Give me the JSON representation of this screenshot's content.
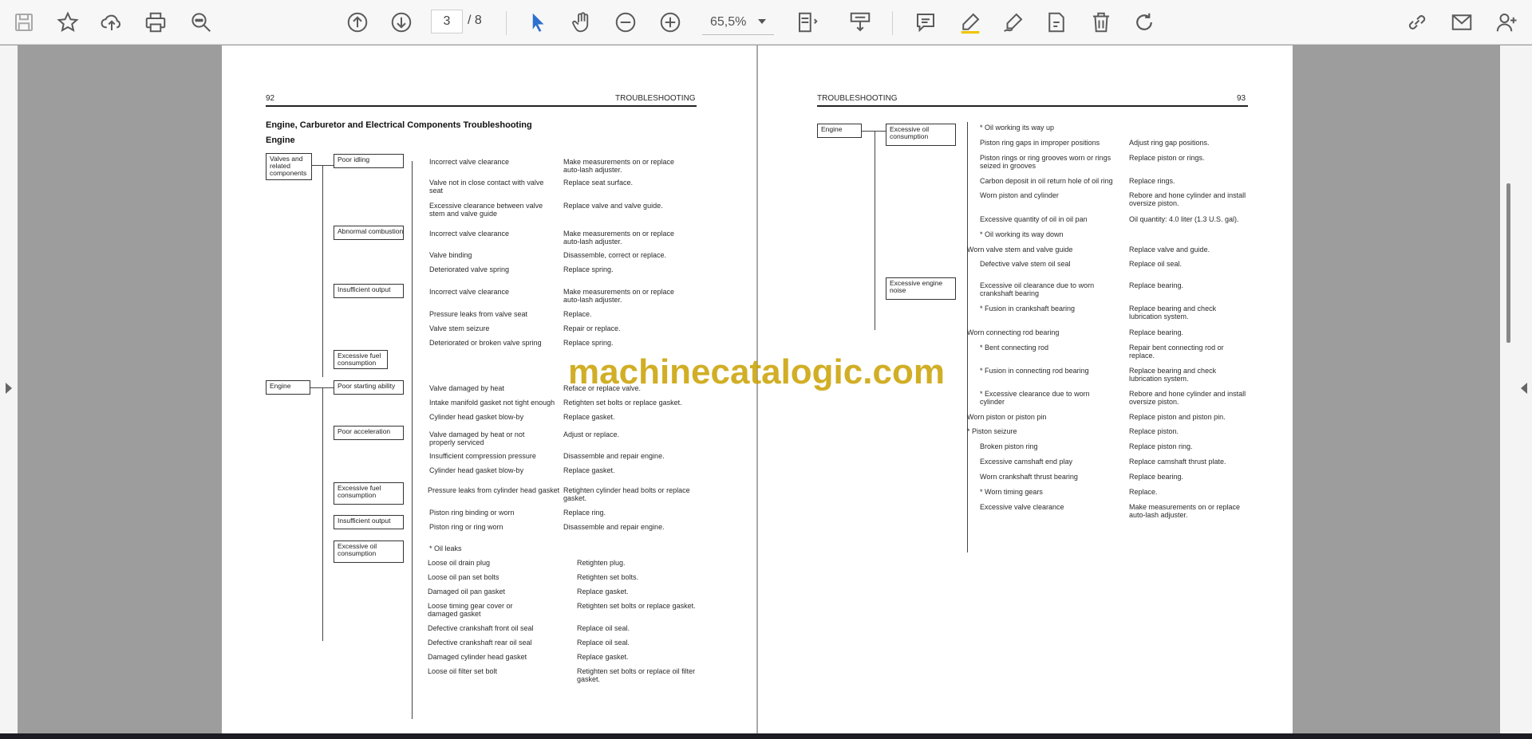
{
  "toolbar": {
    "page_current": "3",
    "page_total": "/ 8",
    "zoom": "65,5%",
    "icons": [
      "save-icon",
      "bookmark-star-icon",
      "upload-cloud-icon",
      "print-icon",
      "zoom-search-icon",
      "page-up-icon",
      "page-down-icon",
      "select-cursor-icon",
      "hand-tool-icon",
      "zoom-out-icon",
      "zoom-in-icon",
      "fit-page-icon",
      "read-mode-icon",
      "comment-icon",
      "highlight-pen-icon",
      "draw-pen-icon",
      "stamp-icon",
      "delete-icon",
      "rotate-icon",
      "share-link-icon",
      "email-icon",
      "add-user-icon"
    ]
  },
  "colors": {
    "toolbar_icon": "#5b5b5b",
    "active_icon": "#2f6fce",
    "watermark": "#c9a000"
  },
  "left_page": {
    "page_number": "92",
    "header": "TROUBLESHOOTING",
    "title": "Engine, Carburetor and Electrical Components Troubleshooting",
    "subtitle": "Engine",
    "groups": [
      {
        "box": "Valves and related components"
      },
      {
        "box": "Engine"
      }
    ],
    "symptoms": [
      "Poor idling",
      "Abnormal combustion",
      "Insufficient output",
      "Excessive fuel consumption",
      "Poor starting ability",
      "Poor acceleration",
      "Excessive fuel consumption",
      "Insufficient output",
      "Excessive oil consumption"
    ],
    "rows": [
      {
        "cause": "Incorrect valve clearance",
        "remedy": "Make measurements on or replace auto-lash adjuster."
      },
      {
        "cause": "Valve not in close contact with valve seat",
        "remedy": "Replace seat surface."
      },
      {
        "cause": "Excessive clearance between valve stem and valve guide",
        "remedy": "Replace valve and valve guide."
      },
      {
        "cause": "Incorrect valve clearance",
        "remedy": "Make measurements on or replace auto-lash adjuster."
      },
      {
        "cause": "Valve binding",
        "remedy": "Disassemble, correct or replace."
      },
      {
        "cause": "Deteriorated valve spring",
        "remedy": "Replace spring."
      },
      {
        "cause": "Incorrect valve clearance",
        "remedy": "Make measurements on or replace auto-lash adjuster."
      },
      {
        "cause": "Pressure leaks from valve seat",
        "remedy": "Replace."
      },
      {
        "cause": "Valve stem seizure",
        "remedy": "Repair or replace."
      },
      {
        "cause": "Deteriorated or broken valve spring",
        "remedy": "Replace spring."
      },
      {
        "cause": "Valve damaged by heat",
        "remedy": "Reface or replace valve."
      },
      {
        "cause": "Intake manifold gasket not tight enough",
        "remedy": "Retighten set bolts or replace gasket."
      },
      {
        "cause": "Cylinder head gasket blow-by",
        "remedy": "Replace gasket."
      },
      {
        "cause": "Valve damaged by heat or not properly serviced",
        "remedy": "Adjust or replace."
      },
      {
        "cause": "Insufficient compression pressure",
        "remedy": "Disassemble and repair engine."
      },
      {
        "cause": "Cylinder head gasket blow-by",
        "remedy": "Replace gasket."
      },
      {
        "cause": "Pressure leaks from cylinder head gasket",
        "remedy": "Retighten cylinder head bolts or replace gasket."
      },
      {
        "cause": "Piston ring binding or worn",
        "remedy": "Replace ring."
      },
      {
        "cause": "Piston ring or ring worn",
        "remedy": "Disassemble and repair engine."
      },
      {
        "cause": "* Oil leaks",
        "remedy": ""
      },
      {
        "cause": "Loose oil drain plug",
        "remedy": "Retighten plug."
      },
      {
        "cause": "Loose oil pan set bolts",
        "remedy": "Retighten set bolts."
      },
      {
        "cause": "Damaged oil pan gasket",
        "remedy": "Replace gasket."
      },
      {
        "cause": "Loose timing gear cover or damaged gasket",
        "remedy": "Retighten set bolts or replace gasket."
      },
      {
        "cause": "Defective crankshaft front oil seal",
        "remedy": "Replace oil seal."
      },
      {
        "cause": "Defective crankshaft rear oil seal",
        "remedy": "Replace oil seal."
      },
      {
        "cause": "Damaged cylinder head gasket",
        "remedy": "Replace gasket."
      },
      {
        "cause": "Loose oil filter set bolt",
        "remedy": "Retighten set bolts or replace oil filter gasket."
      }
    ]
  },
  "right_page": {
    "page_number": "93",
    "header": "TROUBLESHOOTING",
    "group": "Engine",
    "symptoms": [
      "Excessive oil consumption",
      "Excessive engine noise"
    ],
    "rows": [
      {
        "cause": "* Oil working its way up",
        "remedy": ""
      },
      {
        "cause": "Piston ring gaps in improper positions",
        "remedy": "Adjust ring gap positions."
      },
      {
        "cause": "Piston rings or ring grooves worn or rings seized in grooves",
        "remedy": "Replace piston or rings."
      },
      {
        "cause": "Carbon deposit in oil return hole of oil ring",
        "remedy": "Replace rings."
      },
      {
        "cause": "Worn piston and cylinder",
        "remedy": "Rebore and hone cylinder and install oversize piston."
      },
      {
        "cause": "Excessive quantity of oil in oil pan",
        "remedy": "Oil quantity: 4.0 liter (1.3 U.S. gal)."
      },
      {
        "cause": "* Oil working its way down",
        "remedy": ""
      },
      {
        "cause": "Worn valve stem and valve guide",
        "remedy": "Replace valve and guide."
      },
      {
        "cause": "Defective valve stem oil seal",
        "remedy": "Replace oil seal."
      },
      {
        "cause": "Excessive oil clearance due to worn crankshaft bearing",
        "remedy": "Replace bearing."
      },
      {
        "cause": "* Fusion in crankshaft bearing",
        "remedy": "Replace bearing and check lubrication system."
      },
      {
        "cause": "Worn connecting rod bearing",
        "remedy": "Replace bearing."
      },
      {
        "cause": "* Bent connecting rod",
        "remedy": "Repair bent connecting rod or replace."
      },
      {
        "cause": "* Fusion in connecting rod bearing",
        "remedy": "Replace bearing and check lubrication system."
      },
      {
        "cause": "* Excessive clearance due to worn cylinder",
        "remedy": "Rebore and hone cylinder and install oversize piston."
      },
      {
        "cause": "Worn piston or piston pin",
        "remedy": "Replace piston and piston pin."
      },
      {
        "cause": "* Piston seizure",
        "remedy": "Replace piston."
      },
      {
        "cause": "Broken piston ring",
        "remedy": "Replace piston ring."
      },
      {
        "cause": "Excessive camshaft end play",
        "remedy": "Replace camshaft thrust plate."
      },
      {
        "cause": "Worn crankshaft thrust bearing",
        "remedy": "Replace bearing."
      },
      {
        "cause": "* Worn timing gears",
        "remedy": "Replace."
      },
      {
        "cause": "Excessive valve clearance",
        "remedy": "Make measurements on or replace auto-lash adjuster."
      }
    ]
  },
  "watermark": "machinecatalogic.com"
}
